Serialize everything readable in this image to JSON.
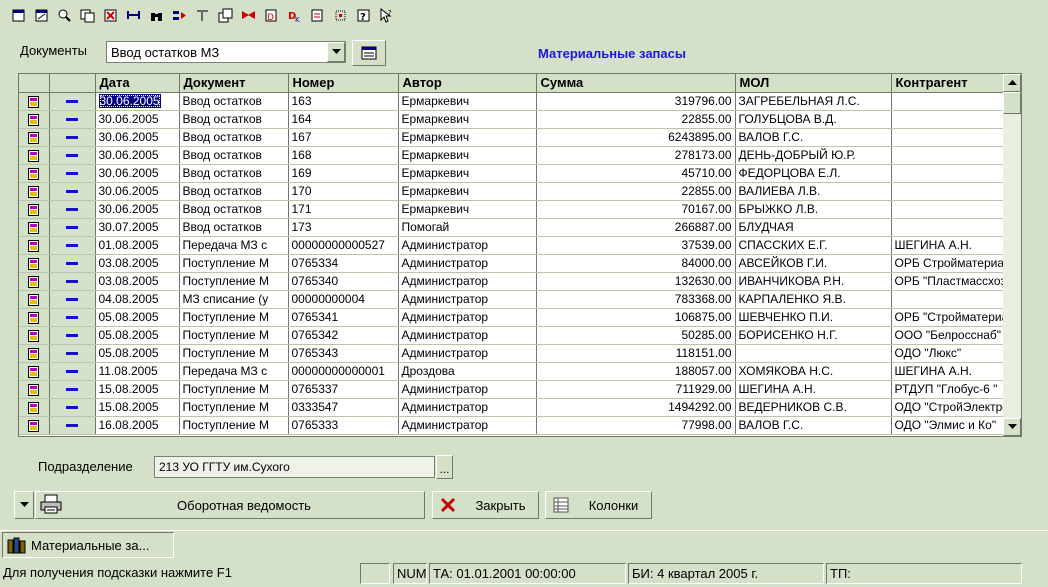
{
  "toolbar": {
    "icons": [
      "new-doc-icon",
      "edit-doc-icon",
      "view-doc-icon",
      "copy-doc-icon",
      "delete-doc-icon",
      "link-icon",
      "find-icon",
      "filter-icon",
      "sort-icon",
      "refresh-icon",
      "print-icon",
      "post-icon",
      "unpost-icon",
      "properties-icon",
      "tree-icon",
      "help-icon",
      "whats-this-icon"
    ]
  },
  "documents": {
    "label": "Документы",
    "selected": "Ввод остатков МЗ"
  },
  "title": "Материальные запасы",
  "grid": {
    "columns": [
      "Дата",
      "Документ",
      "Номер",
      "Автор",
      "Сумма",
      "МОЛ",
      "Контрагент"
    ],
    "rows": [
      {
        "date": "30.06.2005",
        "doc": "Ввод остатков",
        "num": "163",
        "author": "Ермаркевич",
        "sum": "319796.00",
        "mol": "ЗАГРЕБЕЛЬНАЯ Л.С.",
        "agent": ""
      },
      {
        "date": "30.06.2005",
        "doc": "Ввод остатков",
        "num": "164",
        "author": "Ермаркевич",
        "sum": "22855.00",
        "mol": "ГОЛУБЦОВА В.Д.",
        "agent": ""
      },
      {
        "date": "30.06.2005",
        "doc": "Ввод остатков",
        "num": "167",
        "author": "Ермаркевич",
        "sum": "6243895.00",
        "mol": "ВАЛОВ Г.С.",
        "agent": ""
      },
      {
        "date": "30.06.2005",
        "doc": "Ввод остатков",
        "num": "168",
        "author": "Ермаркевич",
        "sum": "278173.00",
        "mol": "ДЕНЬ-ДОБРЫЙ Ю.Р.",
        "agent": ""
      },
      {
        "date": "30.06.2005",
        "doc": "Ввод остатков",
        "num": "169",
        "author": "Ермаркевич",
        "sum": "45710.00",
        "mol": "ФЕДОРЦОВА Е.Л.",
        "agent": ""
      },
      {
        "date": "30.06.2005",
        "doc": "Ввод остатков",
        "num": "170",
        "author": "Ермаркевич",
        "sum": "22855.00",
        "mol": "ВАЛИЕВА Л.В.",
        "agent": ""
      },
      {
        "date": "30.06.2005",
        "doc": "Ввод остатков",
        "num": "171",
        "author": "Ермаркевич",
        "sum": "70167.00",
        "mol": "БРЫЖКО Л.В.",
        "agent": ""
      },
      {
        "date": "30.07.2005",
        "doc": "Ввод остатков",
        "num": "173",
        "author": "Помогай",
        "sum": "266887.00",
        "mol": "БЛУДЧАЯ",
        "agent": ""
      },
      {
        "date": "01.08.2005",
        "doc": "Передача МЗ с",
        "num": "00000000000527",
        "author": "Администратор",
        "sum": "37539.00",
        "mol": "СПАССКИХ Е.Г.",
        "agent": "ШЕГИНА А.Н."
      },
      {
        "date": "03.08.2005",
        "doc": "Поступление М",
        "num": "0765334",
        "author": "Администратор",
        "sum": "84000.00",
        "mol": "АВСЕЙКОВ Г.И.",
        "agent": "ОРБ Стройматериалы"
      },
      {
        "date": "03.08.2005",
        "doc": "Поступление М",
        "num": "0765340",
        "author": "Администратор",
        "sum": "132630.00",
        "mol": "ИВАНЧИКОВА Р.Н.",
        "agent": "ОРБ \"Пластмассхозтор"
      },
      {
        "date": "04.08.2005",
        "doc": "МЗ списание (у",
        "num": "00000000004",
        "author": "Администратор",
        "sum": "783368.00",
        "mol": "КАРПАЛЕНКО Я.В.",
        "agent": ""
      },
      {
        "date": "05.08.2005",
        "doc": "Поступление М",
        "num": "0765341",
        "author": "Администратор",
        "sum": "106875.00",
        "mol": "ШЕВЧЕНКО П.И.",
        "agent": "ОРБ \"Стройматериалы"
      },
      {
        "date": "05.08.2005",
        "doc": "Поступление М",
        "num": "0765342",
        "author": "Администратор",
        "sum": "50285.00",
        "mol": "БОРИСЕНКО Н.Г.",
        "agent": "ООО \"Белросснаб\""
      },
      {
        "date": "05.08.2005",
        "doc": "Поступление М",
        "num": "0765343",
        "author": "Администратор",
        "sum": "118151.00",
        "mol": "",
        "agent": "ОДО \"Люкс\""
      },
      {
        "date": "11.08.2005",
        "doc": "Передача МЗ с",
        "num": "00000000000001",
        "author": "Дроздова",
        "sum": "188057.00",
        "mol": "ХОМЯКОВА Н.С.",
        "agent": "ШЕГИНА А.Н."
      },
      {
        "date": "15.08.2005",
        "doc": "Поступление М",
        "num": "0765337",
        "author": "Администратор",
        "sum": "711929.00",
        "mol": "ШЕГИНА А.Н.",
        "agent": "РТДУП \"Глобус-6 \""
      },
      {
        "date": "15.08.2005",
        "doc": "Поступление М",
        "num": "0333547",
        "author": "Администратор",
        "sum": "1494292.00",
        "mol": "ВЕДЕРНИКОВ С.В.",
        "agent": "ОДО \"СтройЭлектроСн"
      },
      {
        "date": "16.08.2005",
        "doc": "Поступление М",
        "num": "0765333",
        "author": "Администратор",
        "sum": "77998.00",
        "mol": "ВАЛОВ Г.С.",
        "agent": "ОДО \"Элмис и Ко\""
      }
    ]
  },
  "subdivision": {
    "label": "Подразделение",
    "value": "213 УО ГГТУ им.Сухого",
    "button": "..."
  },
  "buttons": {
    "turnover": "Оборотная ведомость",
    "close": "Закрыть",
    "columns": "Колонки"
  },
  "taskbar": {
    "window": "Материальные за..."
  },
  "status": {
    "hint": "Для получения подсказки нажмите F1",
    "num": "NUM",
    "ta": "ТА: 01.01.2001  00:00:00",
    "bi": "БИ: 4 квартал 2005 г.",
    "tp": "ТП:"
  },
  "colors": {
    "background": "#d4e0c8",
    "title": "#1a1ad6",
    "selection": "#000080"
  }
}
